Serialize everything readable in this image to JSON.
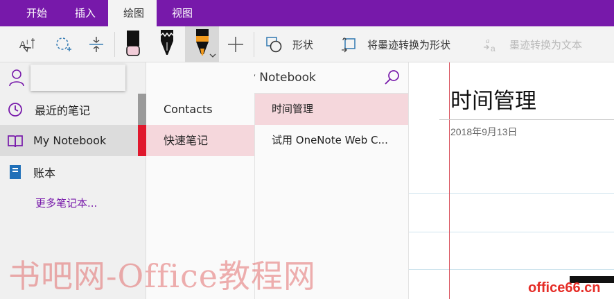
{
  "ribbon": {
    "tabs": [
      {
        "label": "开始"
      },
      {
        "label": "插入"
      },
      {
        "label": "绘图",
        "active": true
      },
      {
        "label": "视图"
      }
    ],
    "accent_color": "#7719AA",
    "toolbar": {
      "tools": [
        {
          "icon": "text-select-icon"
        },
        {
          "icon": "lasso-select-icon"
        },
        {
          "icon": "insert-space-icon"
        },
        {
          "icon": "eraser-icon"
        },
        {
          "icon": "pen-black-icon"
        },
        {
          "icon": "highlighter-orange-icon",
          "selected": true
        },
        {
          "icon": "add-pen-icon"
        }
      ],
      "shapes_label": "形状",
      "ink_to_shape_label": "将墨迹转换为形状",
      "ink_to_text_label": "墨迹转换为文本",
      "ink_to_text_enabled": false
    }
  },
  "notebook_nav": {
    "account_icon": "person-icon",
    "items": [
      {
        "label": "最近的笔记",
        "icon": "clock-icon",
        "strip_color": "#9a9a9a"
      },
      {
        "label": "My Notebook",
        "icon": "book-icon",
        "selected": true,
        "strip_color": "#e0182d"
      },
      {
        "label": "账本",
        "icon": "notebook-blue-icon"
      }
    ],
    "more_label": "更多笔记本..."
  },
  "notebook_header": {
    "title": "My Notebook",
    "search_icon": "search-icon"
  },
  "sections": [
    {
      "label": "Contacts"
    },
    {
      "label": "快速笔记",
      "active": true
    }
  ],
  "pages": [
    {
      "label": "时间管理",
      "active": true
    },
    {
      "label": "试用 OneNote Web C..."
    }
  ],
  "page": {
    "title": "时间管理",
    "date": "2018年9月13日"
  },
  "watermarks": {
    "main": "书吧网-Office教程网",
    "corner": "office66.cn"
  }
}
